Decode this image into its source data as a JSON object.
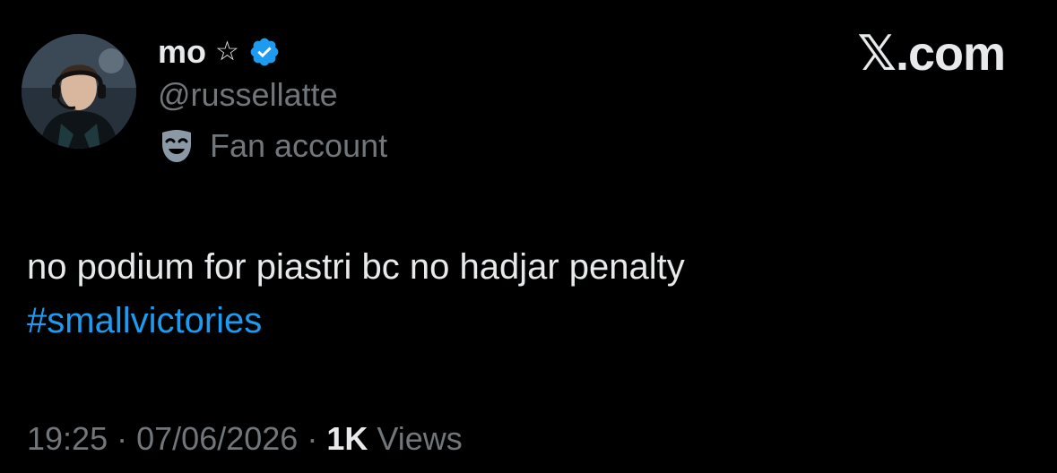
{
  "header": {
    "display_name": "mo",
    "name_emoji": "☆",
    "handle": "@russellatte",
    "account_label": "Fan account",
    "brand": "𝕏.com"
  },
  "tweet": {
    "text": "no podium for piastri bc no hadjar penalty",
    "hashtag": "#smallvictories"
  },
  "meta": {
    "time": "19:25",
    "separator": "·",
    "date": "07/06/2026",
    "views_count": "1K",
    "views_label": "Views"
  },
  "icons": {
    "verified": "verified-badge-icon",
    "account_label": "theater-mask-icon"
  },
  "colors": {
    "background": "#000000",
    "text_primary": "#e7e9ea",
    "text_secondary": "#71767b",
    "link": "#1d9bf0",
    "verified": "#1d9bf0"
  }
}
